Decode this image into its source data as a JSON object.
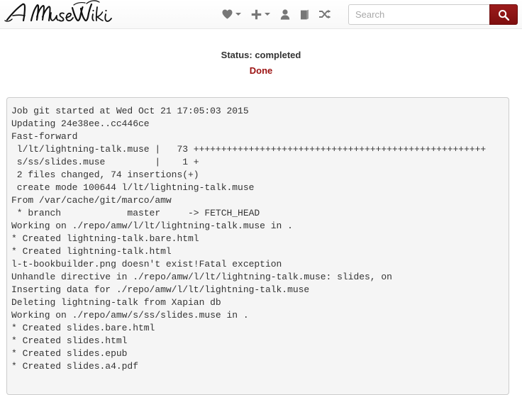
{
  "navbar": {
    "brand_text": "A MuseWiki",
    "items": [
      {
        "name": "favorites",
        "icon": "heart-icon",
        "has_caret": true
      },
      {
        "name": "create",
        "icon": "plus-icon",
        "has_caret": true
      },
      {
        "name": "user",
        "icon": "user-icon",
        "has_caret": true
      },
      {
        "name": "book",
        "icon": "book-icon",
        "has_caret": false
      },
      {
        "name": "random",
        "icon": "shuffle-icon",
        "has_caret": false
      }
    ],
    "search": {
      "placeholder": "Search",
      "value": "",
      "button_icon": "search-icon"
    }
  },
  "status": {
    "label": "Status: completed",
    "result": "Done",
    "result_color": "#9b1111"
  },
  "log": {
    "text": "Job git started at Wed Oct 21 17:05:03 2015\nUpdating 24e38ee..cc446ce\nFast-forward\n l/lt/lightning-talk.muse |   73 +++++++++++++++++++++++++++++++++++++++++++++++++++++\n s/ss/slides.muse         |    1 +\n 2 files changed, 74 insertions(+)\n create mode 100644 l/lt/lightning-talk.muse\nFrom /var/cache/git/marco/amw\n * branch            master     -> FETCH_HEAD\nWorking on ./repo/amw/l/lt/lightning-talk.muse in .\n* Created lightning-talk.bare.html\n* Created lightning-talk.html\nl-t-bookbuilder.png doesn't exist!Fatal exception\nUnhandle directive in ./repo/amw/l/lt/lightning-talk.muse: slides, on\nInserting data for ./repo/amw/l/lt/lightning-talk.muse\nDeleting lightning-talk from Xapian db\nWorking on ./repo/amw/s/ss/slides.muse in .\n* Created slides.bare.html\n* Created slides.html\n* Created slides.epub\n* Created slides.a4.pdf"
  }
}
